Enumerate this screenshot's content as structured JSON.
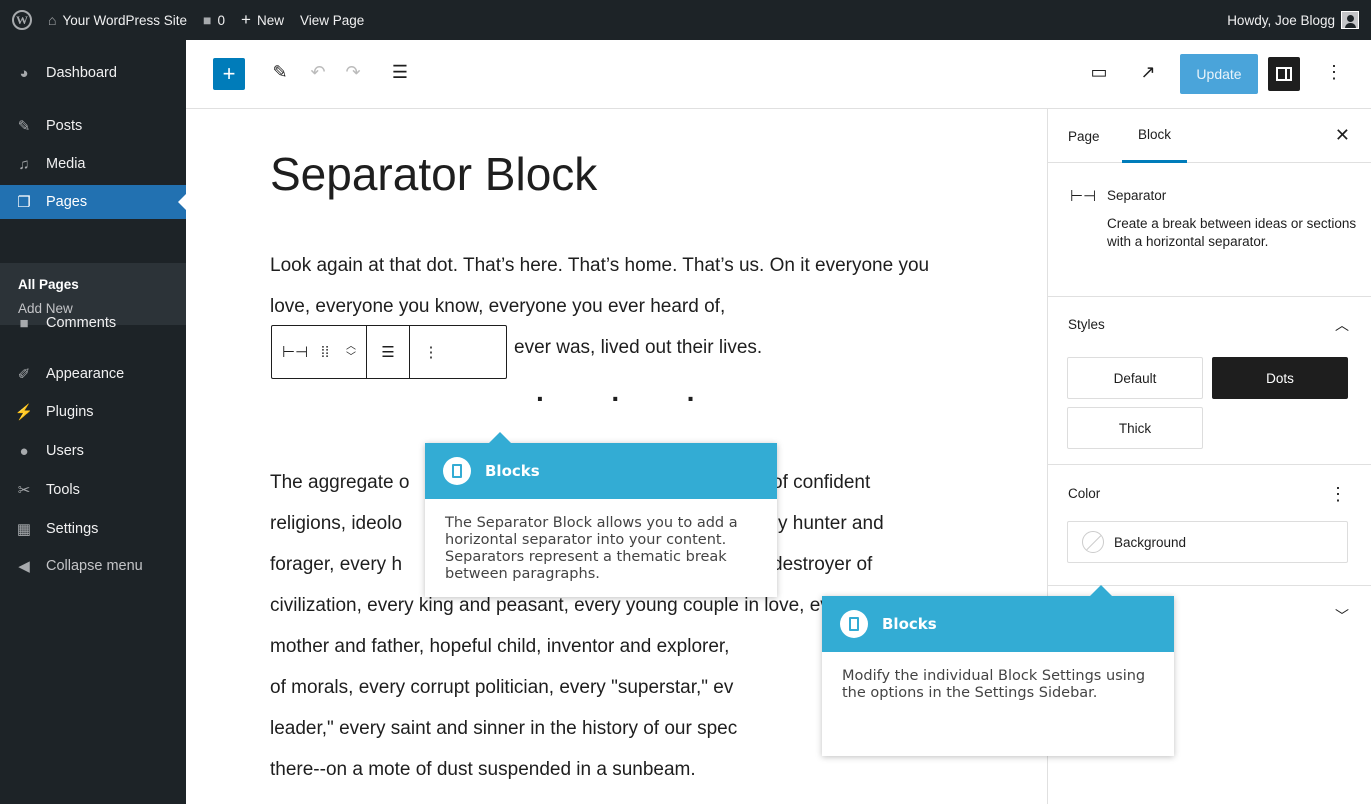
{
  "adminbar": {
    "site_name": "Your WordPress Site",
    "comments_count": "0",
    "new_label": "New",
    "view_label": "View Page",
    "howdy": "Howdy, Joe Blogg"
  },
  "sidebar": {
    "items": [
      {
        "label": "Dashboard",
        "icon": "dashboard-icon"
      },
      {
        "label": "Posts",
        "icon": "pin-icon"
      },
      {
        "label": "Media",
        "icon": "media-icon"
      },
      {
        "label": "Pages",
        "icon": "pages-icon"
      },
      {
        "label": "Comments",
        "icon": "comment-icon"
      },
      {
        "label": "Appearance",
        "icon": "brush-icon"
      },
      {
        "label": "Plugins",
        "icon": "plugin-icon"
      },
      {
        "label": "Users",
        "icon": "users-icon"
      },
      {
        "label": "Tools",
        "icon": "wrench-icon"
      },
      {
        "label": "Settings",
        "icon": "settings-icon"
      },
      {
        "label": "Collapse menu",
        "icon": "collapse-icon"
      }
    ],
    "submenu": [
      "All Pages",
      "Add New"
    ]
  },
  "header": {
    "update_label": "Update"
  },
  "content": {
    "title": "Separator Block",
    "para1": "Look again at that dot. That’s here. That’s home. That’s us. On it everyone you love, everyone you know, everyone you ever heard of,",
    "para1_tail": "ever was, lived out their lives.",
    "para2_lines": [
      "The aggregate o",
      "religions, ideolo",
      "forager, every h",
      "civilization, every king and peasant, every young couple in love, every",
      "mother and father, hopeful child, inventor and explorer,",
      "of morals, every corrupt politician, every \"superstar,\" ev",
      "leader,\" every saint and sinner in the history of our spec",
      "there--on a mote of dust suspended in a sunbeam."
    ],
    "para2_right": [
      "of confident",
      "y hunter and",
      "destroyer of"
    ]
  },
  "tooltips": {
    "tip1_title": "Blocks",
    "tip1_body": "The Separator Block allows you to add a horizontal separator into your content. Separators represent a thematic break between paragraphs.",
    "tip2_title": "Blocks",
    "tip2_body": "Modify the individual Block Settings using the options in the Settings Sidebar."
  },
  "settings": {
    "tab_page": "Page",
    "tab_block": "Block",
    "block_name": "Separator",
    "block_desc": "Create a break between ideas or sections with a horizontal separator.",
    "styles_title": "Styles",
    "style_default": "Default",
    "style_dots": "Dots",
    "style_thick": "Thick",
    "color_title": "Color",
    "color_background": "Background"
  },
  "colors": {
    "admin_dark": "#1d2327",
    "accent": "#2271b1",
    "tooltip": "#33acd4"
  }
}
